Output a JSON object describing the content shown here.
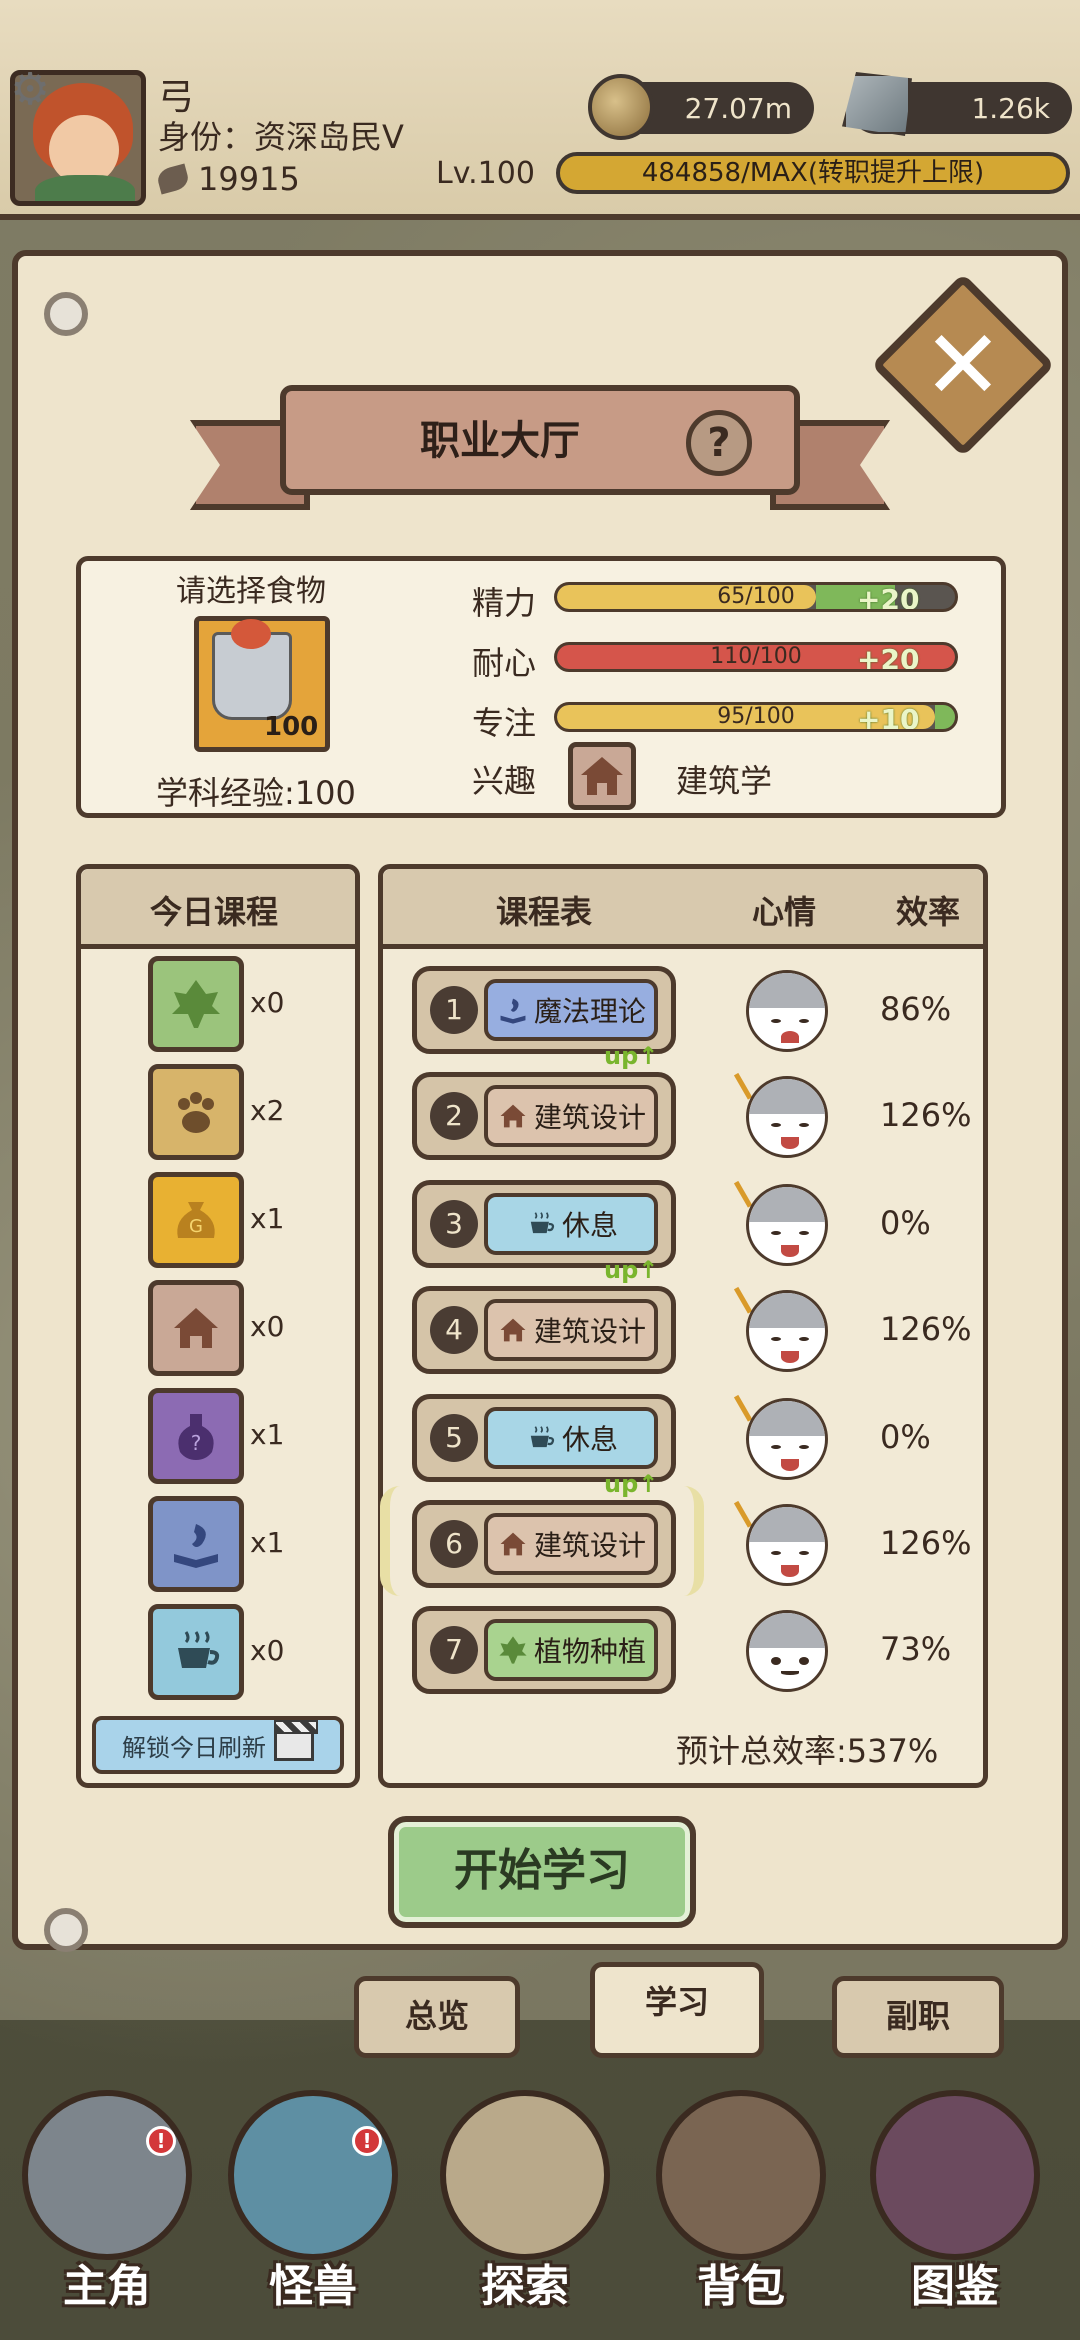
{
  "header": {
    "player_name": "弓",
    "identity": "身份：资深岛民V",
    "power": "19915",
    "gold": "27.07m",
    "stone": "1.26k",
    "level": "Lv.100",
    "exp_text": "484858/MAX(转职提升上限)"
  },
  "panel": {
    "title": "职业大厅",
    "help_icon": "?",
    "close_icon": "✕"
  },
  "food": {
    "label": "请选择食物",
    "count": "100",
    "subject_exp": "学科经验:100"
  },
  "stats": [
    {
      "label": "精力",
      "text": "65/100",
      "bonus": "+20",
      "fraction": 0.65,
      "bonus_fraction": 0.2,
      "color": "#e9c35a"
    },
    {
      "label": "耐心",
      "text": "110/100",
      "bonus": "+20",
      "fraction": 1.0,
      "bonus_fraction": 0.2,
      "color": "#d5554b"
    },
    {
      "label": "专注",
      "text": "95/100",
      "bonus": "+10",
      "fraction": 0.95,
      "bonus_fraction": 0.1,
      "color": "#e9c35a"
    }
  ],
  "interest": {
    "label": "兴趣",
    "value": "建筑学",
    "icon": "house-icon"
  },
  "today": {
    "title": "今日课程",
    "items": [
      {
        "icon": "leaf-icon",
        "count": "x0",
        "bg": "#9bc47c"
      },
      {
        "icon": "paw-icon",
        "count": "x2",
        "bg": "#d7b46a"
      },
      {
        "icon": "money-bag-icon",
        "count": "x1",
        "bg": "#e8b132"
      },
      {
        "icon": "house-icon",
        "count": "x0",
        "bg": "#c9a896"
      },
      {
        "icon": "potion-icon",
        "count": "x1",
        "bg": "#8c6bb3"
      },
      {
        "icon": "magic-book-icon",
        "count": "x1",
        "bg": "#7f94c8"
      },
      {
        "icon": "tea-cup-icon",
        "count": "x0",
        "bg": "#93c9dc"
      }
    ],
    "refresh_label": "解锁今日刷新"
  },
  "schedule": {
    "col_course": "课程表",
    "col_mood": "心情",
    "col_eff": "效率",
    "up_text": "up↑",
    "slots": [
      {
        "num": "1",
        "name": "魔法理论",
        "efficiency": "86%",
        "bg": "#97aee0",
        "icon": "magic-book-icon",
        "up": false,
        "mood": "crying"
      },
      {
        "num": "2",
        "name": "建筑设计",
        "efficiency": "126%",
        "bg": "#dcc3ad",
        "icon": "house-icon",
        "up": true,
        "mood": "happy"
      },
      {
        "num": "3",
        "name": "休息",
        "efficiency": "0%",
        "bg": "#a8d6e6",
        "icon": "tea-cup-icon",
        "up": false,
        "mood": "happy"
      },
      {
        "num": "4",
        "name": "建筑设计",
        "efficiency": "126%",
        "bg": "#dcc3ad",
        "icon": "house-icon",
        "up": true,
        "mood": "happy"
      },
      {
        "num": "5",
        "name": "休息",
        "efficiency": "0%",
        "bg": "#a8d6e6",
        "icon": "tea-cup-icon",
        "up": false,
        "mood": "happy"
      },
      {
        "num": "6",
        "name": "建筑设计",
        "efficiency": "126%",
        "bg": "#dcc3ad",
        "icon": "house-icon",
        "up": true,
        "mood": "happy"
      },
      {
        "num": "7",
        "name": "植物种植",
        "efficiency": "73%",
        "bg": "#a9d38f",
        "icon": "leaf-icon",
        "up": false,
        "mood": "neutral"
      }
    ],
    "total": "预计总效率:537%"
  },
  "start_label": "开始学习",
  "tabs": [
    {
      "label": "总览"
    },
    {
      "label": "学习"
    },
    {
      "label": "副职"
    }
  ],
  "nav": [
    {
      "label": "主角",
      "icon": "helmet-icon",
      "badge": "!"
    },
    {
      "label": "怪兽",
      "icon": "monster-icon",
      "badge": "!"
    },
    {
      "label": "探索",
      "icon": "map-icon",
      "badge": ""
    },
    {
      "label": "背包",
      "icon": "backpack-icon",
      "badge": ""
    },
    {
      "label": "图鉴",
      "icon": "book-icon",
      "badge": ""
    }
  ]
}
